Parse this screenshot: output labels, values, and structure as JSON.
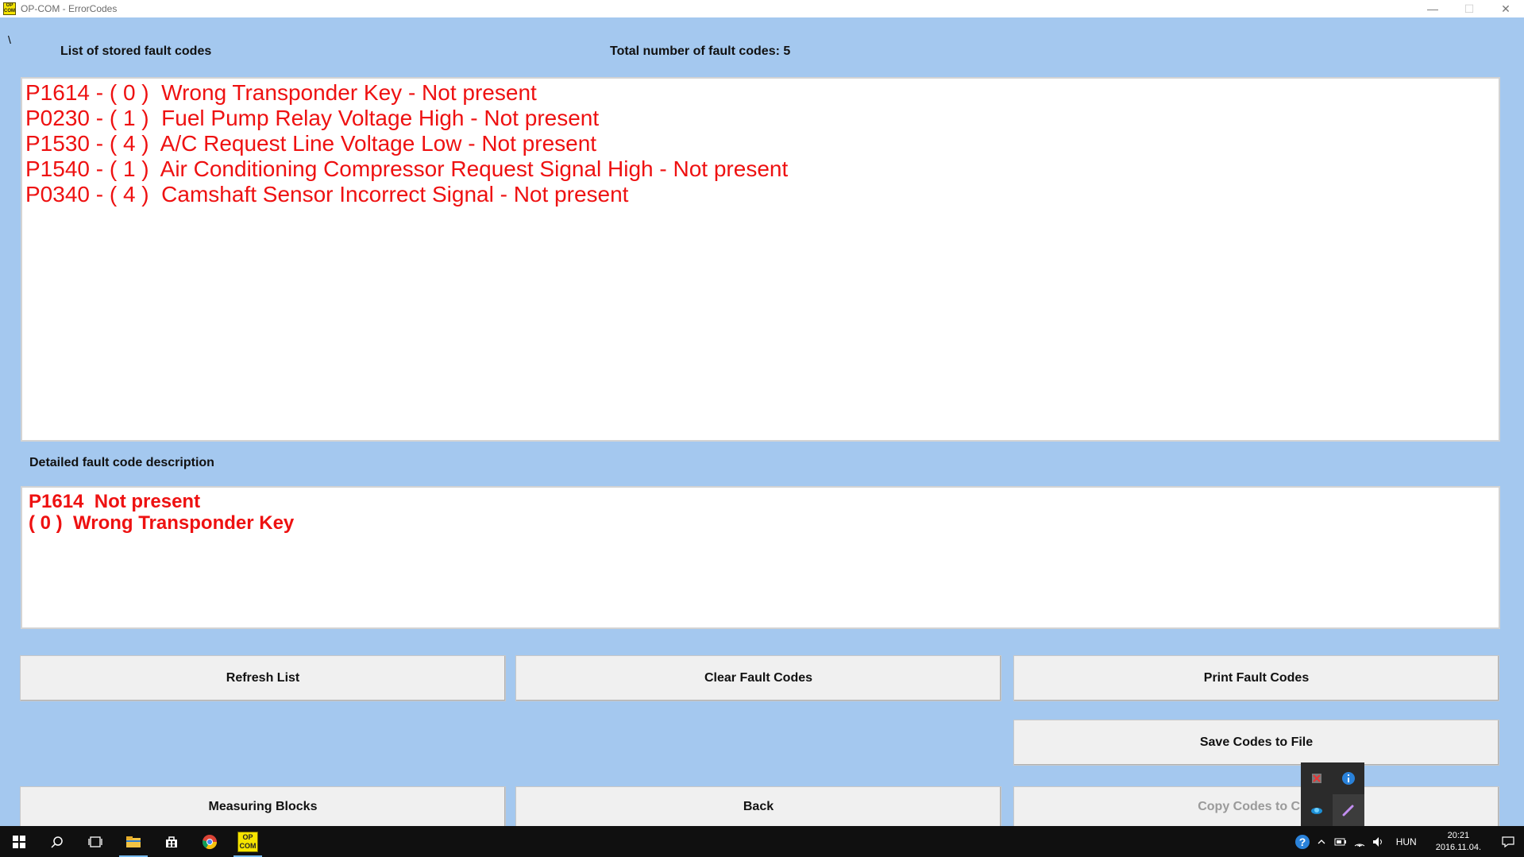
{
  "window": {
    "title": "OP-COM - ErrorCodes",
    "app_icon_text": "OP COM",
    "minimize": "—",
    "maximize": "☐",
    "close": "✕"
  },
  "backslash": "\\",
  "list_title": "List of stored fault codes",
  "total_label": "Total number of fault codes:  5",
  "fault_codes": [
    "P1614 - ( 0 )  Wrong Transponder Key - Not present",
    "P0230 - ( 1 )  Fuel Pump Relay Voltage High - Not present",
    "P1530 - ( 4 )  A/C Request Line Voltage Low - Not present",
    "P1540 - ( 1 )  Air Conditioning Compressor Request Signal High - Not present",
    "P0340 - ( 4 )  Camshaft Sensor Incorrect Signal - Not present"
  ],
  "detail_title": "Detailed fault code description",
  "detail": {
    "line1": "P1614  Not present",
    "line2": "( 0 )  Wrong Transponder Key"
  },
  "buttons": {
    "refresh": "Refresh List",
    "clear": "Clear Fault Codes",
    "print": "Print Fault Codes",
    "save": "Save Codes to File",
    "measuring": "Measuring Blocks",
    "back": "Back",
    "copy": "Copy Codes to Clip"
  },
  "taskbar": {
    "opcom_icon_text": "OP COM",
    "language": "HUN",
    "time": "20:21",
    "date": "2016.11.04."
  },
  "colors": {
    "background": "#a4c8ef",
    "fault_text": "#ee1111",
    "taskbar": "#101010"
  }
}
